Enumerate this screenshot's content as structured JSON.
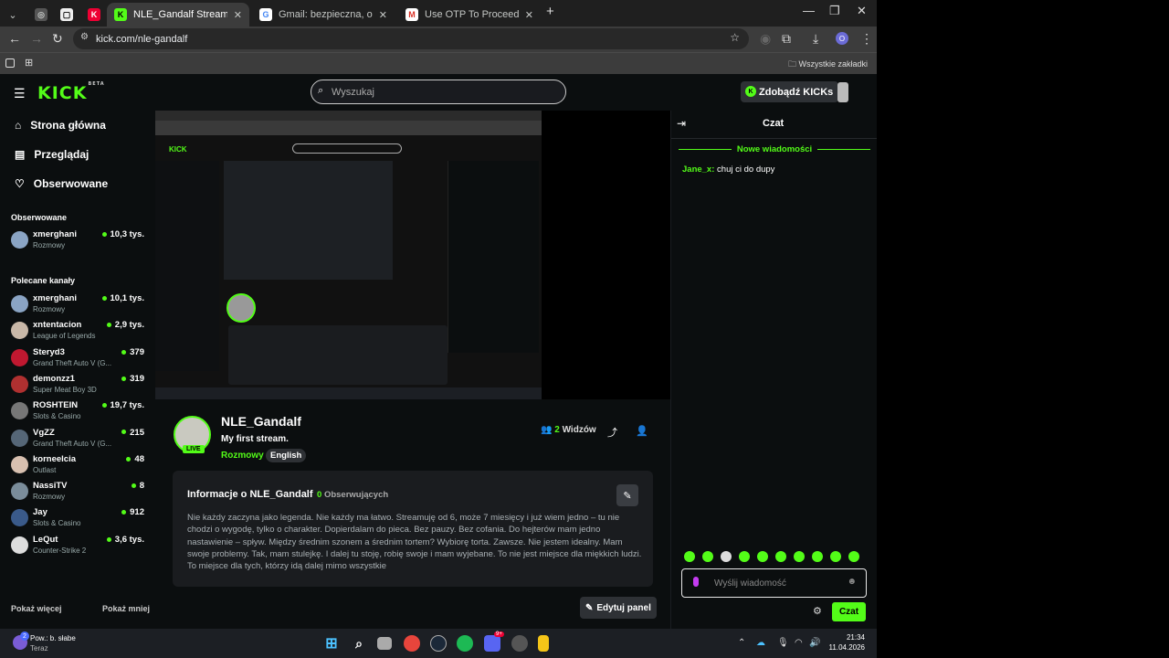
{
  "browser": {
    "tabs": [
      {
        "title": "NLE_Gandalf Stream - Watch Li",
        "active": true
      },
      {
        "title": "Gmail: bezpieczna, oparta na AI"
      },
      {
        "title": "Use OTP To Proceed - oliwierk..."
      }
    ],
    "url": "kick.com/nle-gandalf",
    "bookmarks_all": "Wszystkie zakładki",
    "profile_initial": "O"
  },
  "topnav": {
    "logo": "KICK",
    "logo_beta": "BETA",
    "search_placeholder": "Wyszukaj",
    "kicks_button": "Zdobądź KICKs"
  },
  "sidebar": {
    "nav": [
      {
        "label": "Strona główna",
        "icon": "home-icon"
      },
      {
        "label": "Przeglądaj",
        "icon": "browse-icon"
      },
      {
        "label": "Obserwowane",
        "icon": "heart-icon"
      }
    ],
    "followed_heading": "Obserwowane",
    "followed": [
      {
        "name": "xmerghani",
        "category": "Rozmowy",
        "viewers": "10,3 tys."
      }
    ],
    "recommended_heading": "Polecane kanały",
    "recommended": [
      {
        "name": "xmerghani",
        "category": "Rozmowy",
        "viewers": "10,1 tys."
      },
      {
        "name": "xntentacion",
        "category": "League of Legends",
        "viewers": "2,9 tys."
      },
      {
        "name": "Steryd3",
        "category": "Grand Theft Auto V (G...",
        "viewers": "379"
      },
      {
        "name": "demonzz1",
        "category": "Super Meat Boy 3D",
        "viewers": "319"
      },
      {
        "name": "ROSHTEIN",
        "category": "Slots & Casino",
        "viewers": "19,7 tys."
      },
      {
        "name": "VgZZ",
        "category": "Grand Theft Auto V (G...",
        "viewers": "215"
      },
      {
        "name": "korneelcia",
        "category": "Outlast",
        "viewers": "48"
      },
      {
        "name": "NassiTV",
        "category": "Rozmowy",
        "viewers": "8"
      },
      {
        "name": "Jay",
        "category": "Slots & Casino",
        "viewers": "912"
      },
      {
        "name": "LeQut",
        "category": "Counter-Strike 2",
        "viewers": "3,6 tys."
      }
    ],
    "show_more": "Pokaż więcej",
    "show_less": "Pokaż mniej"
  },
  "stream": {
    "channel": "NLE_Gandalf",
    "title": "My first stream.",
    "category": "Rozmowy",
    "tag": "English",
    "live": "LIVE",
    "viewers_count": "2",
    "viewers_label": "Widzów"
  },
  "about": {
    "title": "Informacje o NLE_Gandalf",
    "followers_count": "0",
    "followers_label": "Obserwujących",
    "text": "Nie każdy zaczyna jako legenda. Nie każdy ma łatwo. Streamuję od 6, może 7 miesięcy i już wiem jedno – tu nie chodzi o wygodę, tylko o charakter. Dopierdalam do pieca. Bez pauzy. Bez cofania. Do hejterów mam jedno nastawienie – spływ. Między średnim szonem a średnim tortem? Wybiorę torta. Zawsze. Nie jestem idealny. Mam swoje problemy. Tak, mam stulejkę. I dalej tu stoję, robię swoje i mam wyjebane. To nie jest miejsce dla miękkich ludzi. To miejsce dla tych, którzy idą dalej mimo wszystkie",
    "edit_panel": "Edytuj panel"
  },
  "chat": {
    "title": "Czat",
    "new_messages": "Nowe wiadomości",
    "messages": [
      {
        "user": "Jane_x",
        "text": "chuj ci do dupy"
      }
    ],
    "input_placeholder": "Wyślij wiadomość",
    "send": "Czat"
  },
  "taskbar": {
    "weather_title": "Pow.: b. słabe",
    "weather_sub": "Teraz",
    "time": "21:34",
    "date": "11.04.2026",
    "discord_badge": "9+",
    "weather_badge": "2"
  },
  "colors": {
    "accent": "#53fc18",
    "page_bg": "#0b0e0f",
    "card_bg": "#1a1c1f"
  }
}
